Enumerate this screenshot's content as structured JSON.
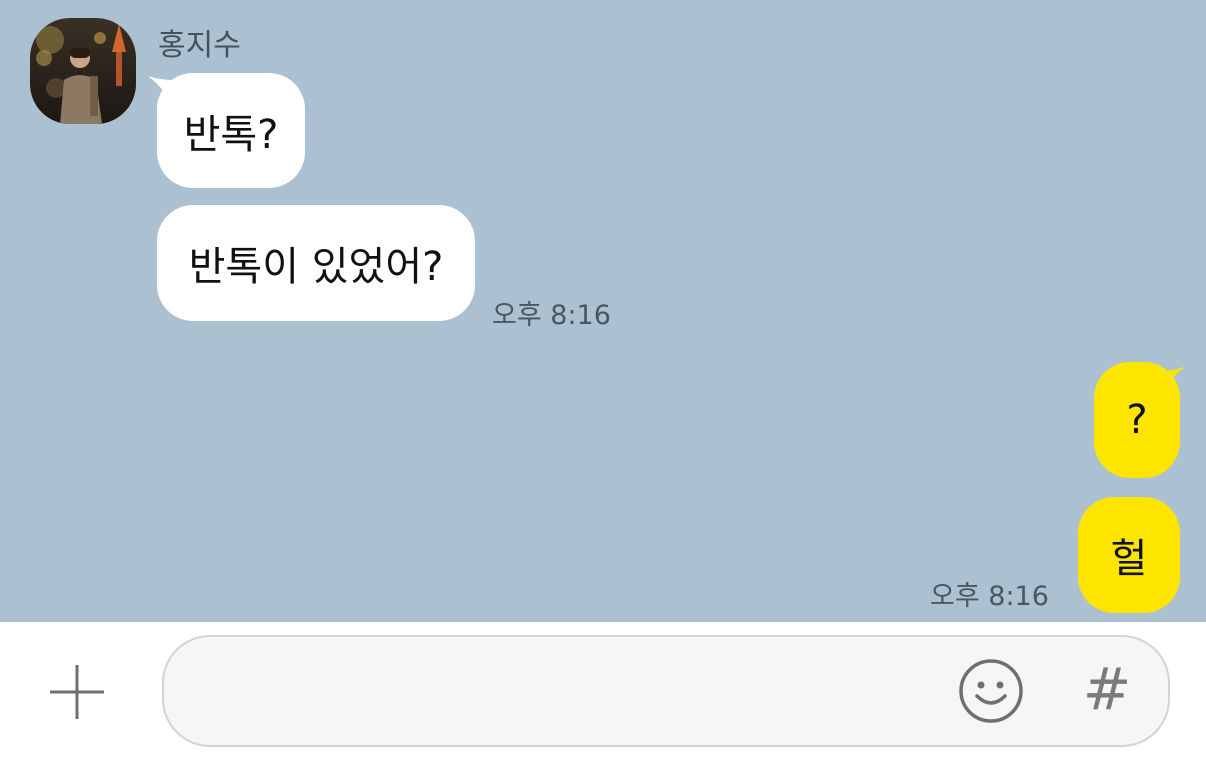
{
  "conversation": {
    "contact": {
      "name": "홍지수",
      "avatar_icon": "profile-photo-icon"
    },
    "messages": [
      {
        "direction": "incoming",
        "text": "반톡?"
      },
      {
        "direction": "incoming",
        "text": "반톡이 있었어?",
        "time": "오후 8:16"
      },
      {
        "direction": "outgoing",
        "text": "?"
      },
      {
        "direction": "outgoing",
        "text": "헐",
        "time": "오후 8:16"
      }
    ]
  },
  "input_bar": {
    "plus_icon": "plus-icon",
    "message_value": "",
    "emoji_icon": "emoji-icon",
    "hash_label": "#"
  },
  "colors": {
    "chat_background": "#abc1d1",
    "incoming_bubble": "#ffffff",
    "outgoing_bubble": "#fee500"
  }
}
